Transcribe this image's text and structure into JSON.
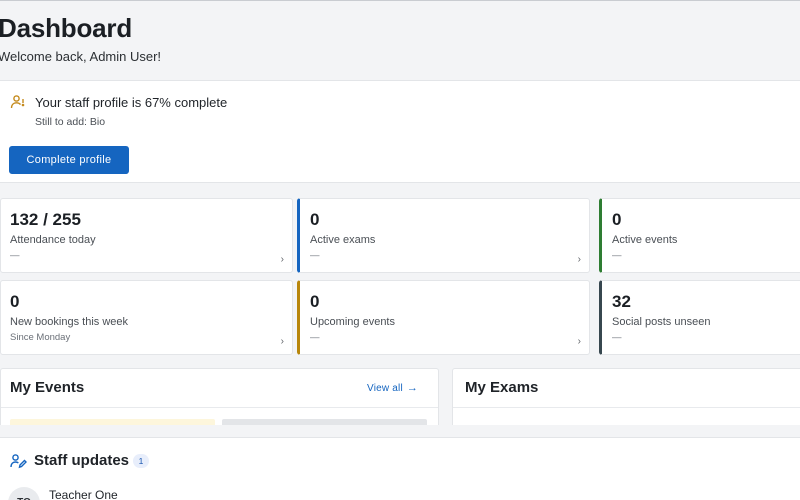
{
  "page": {
    "title": "Dashboard",
    "subtitle": "Welcome back, Admin User!"
  },
  "profile": {
    "icon": "user-progress-icon",
    "title": "Your staff profile is 67% complete",
    "completion_percent": 67,
    "missing": "Still to add: Bio",
    "button_label": "Complete profile"
  },
  "stats": [
    {
      "value": "132 / 255",
      "label": "Attendance today",
      "sub": "—",
      "accent": null
    },
    {
      "value": "0",
      "label": "Active exams",
      "sub": "—",
      "accent": "#1565c0"
    },
    {
      "value": "0",
      "label": "Active events",
      "sub": "—",
      "accent": "#2e7d32"
    },
    {
      "value": "0",
      "label": "New bookings this week",
      "sub": "Since Monday",
      "accent": null
    },
    {
      "value": "0",
      "label": "Upcoming events",
      "sub": "—",
      "accent": "#b8860b"
    },
    {
      "value": "32",
      "label": "Social posts unseen",
      "sub": "—",
      "accent": "#37474f"
    }
  ],
  "stat_chevron": "›",
  "my_events": {
    "title": "My Events",
    "view_all_label": "View all",
    "view_all_arrow": "→"
  },
  "my_exams": {
    "title": "My Exams"
  },
  "staff_updates": {
    "title": "Staff updates",
    "count": "1",
    "items": [
      {
        "initials": "TO",
        "author": "Teacher One"
      }
    ]
  },
  "colors": {
    "primary": "#1565c0",
    "accent_green": "#2e7d32",
    "accent_gold": "#b8860b",
    "accent_slate": "#37474f",
    "profile_icon": "#c48a1c"
  }
}
